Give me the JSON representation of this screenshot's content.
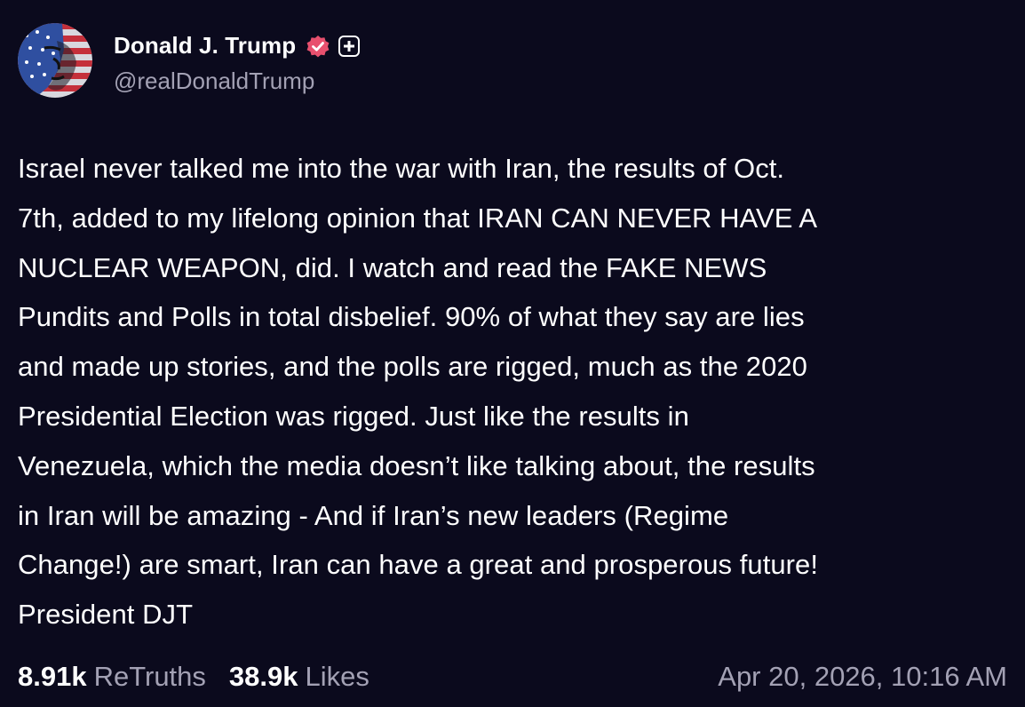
{
  "author": {
    "display_name": "Donald J. Trump",
    "handle": "@realDonaldTrump",
    "verified_icon": "verified-badge-icon",
    "plus_icon": "plus-icon"
  },
  "post": {
    "text": "Israel never talked me into the war with Iran, the results of Oct.\n7th, added to my lifelong opinion that IRAN CAN NEVER HAVE A\nNUCLEAR WEAPON, did. I watch and read the FAKE NEWS\nPundits and Polls in total disbelief. 90% of what they say are lies\nand made up stories, and the polls are rigged, much as the 2020\nPresidential Election was rigged. Just like the results in\nVenezuela, which the media doesn’t like talking about, the results\nin Iran will be amazing - And if Iran’s new leaders (Regime\nChange!) are smart, Iran can have a great and prosperous future!\nPresident DJT"
  },
  "stats": {
    "retruths_count": "8.91k",
    "retruths_label": "ReTruths",
    "likes_count": "38.9k",
    "likes_label": "Likes"
  },
  "timestamp": "Apr 20, 2026, 10:16 AM",
  "colors": {
    "background": "#0b0a1d",
    "text": "#ffffff",
    "muted": "#a3a1b4",
    "verified": "#e8506e"
  }
}
